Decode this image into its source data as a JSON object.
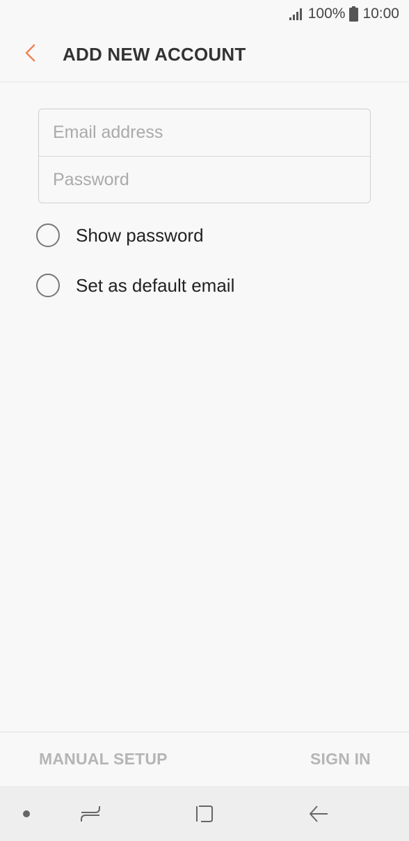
{
  "status_bar": {
    "battery_percent": "100%",
    "time": "10:00",
    "icons": [
      "signal-icon",
      "battery-icon"
    ]
  },
  "app_bar": {
    "title": "ADD NEW ACCOUNT",
    "back_icon": "chevron-left-icon"
  },
  "form": {
    "email_placeholder": "Email address",
    "email_value": "",
    "password_placeholder": "Password",
    "password_value": ""
  },
  "options": [
    {
      "label": "Show password",
      "checked": false
    },
    {
      "label": "Set as default email",
      "checked": false
    }
  ],
  "bottom_actions": {
    "manual_setup_label": "MANUAL SETUP",
    "sign_in_label": "SIGN IN"
  },
  "nav_bar": {
    "items": [
      "dot-icon",
      "recent-apps-icon",
      "home-icon",
      "back-arrow-icon"
    ]
  },
  "colors": {
    "accent": "#f0845a",
    "background": "#f8f8f8",
    "disabled_text": "#b5b5b5"
  }
}
